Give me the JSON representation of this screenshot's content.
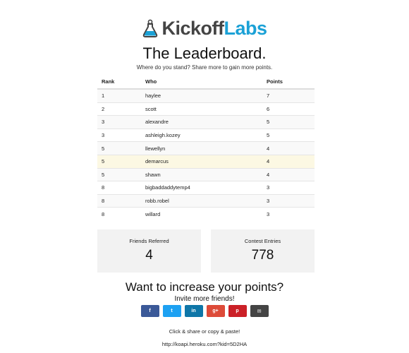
{
  "logo": {
    "part1": "Kickoff",
    "part2": "Labs",
    "icon": "flask-icon",
    "color_part1": "#444444",
    "color_part2": "#1ba1d6"
  },
  "header": {
    "title": "The Leaderboard.",
    "subtitle": "Where do you stand? Share more to gain more points."
  },
  "leaderboard": {
    "columns": [
      "Rank",
      "Who",
      "Points"
    ],
    "highlight_color": "#fcf8e3",
    "rows": [
      {
        "rank": "1",
        "who": "haylee",
        "points": "7"
      },
      {
        "rank": "2",
        "who": "scott",
        "points": "6"
      },
      {
        "rank": "3",
        "who": "alexandre",
        "points": "5"
      },
      {
        "rank": "3",
        "who": "ashleigh.kozey",
        "points": "5"
      },
      {
        "rank": "5",
        "who": "llewellyn",
        "points": "4"
      },
      {
        "rank": "5",
        "who": "demarcus",
        "points": "4",
        "highlight": true
      },
      {
        "rank": "5",
        "who": "shawn",
        "points": "4"
      },
      {
        "rank": "8",
        "who": "bigbaddaddytemp4",
        "points": "3"
      },
      {
        "rank": "8",
        "who": "robb.robel",
        "points": "3"
      },
      {
        "rank": "8",
        "who": "willard",
        "points": "3"
      }
    ]
  },
  "stats": {
    "friends_label": "Friends Referred",
    "friends_value": "4",
    "entries_label": "Contest Entries",
    "entries_value": "778"
  },
  "cta": {
    "heading": "Want to increase your points?",
    "invite": "Invite more friends!"
  },
  "share_buttons": [
    {
      "name": "facebook-icon",
      "glyph": "f",
      "color": "#3b5998"
    },
    {
      "name": "twitter-icon",
      "glyph": "t",
      "color": "#1da1f2"
    },
    {
      "name": "linkedin-icon",
      "glyph": "in",
      "color": "#0e76a8"
    },
    {
      "name": "google-plus-icon",
      "glyph": "g+",
      "color": "#dd4b39"
    },
    {
      "name": "pinterest-icon",
      "glyph": "p",
      "color": "#cb2027"
    },
    {
      "name": "email-icon",
      "glyph": "✉",
      "color": "#444444"
    }
  ],
  "footer": {
    "helper": "Click & share or copy & paste!",
    "link": "http://koapi.heroku.com?kid=5D2HA"
  }
}
